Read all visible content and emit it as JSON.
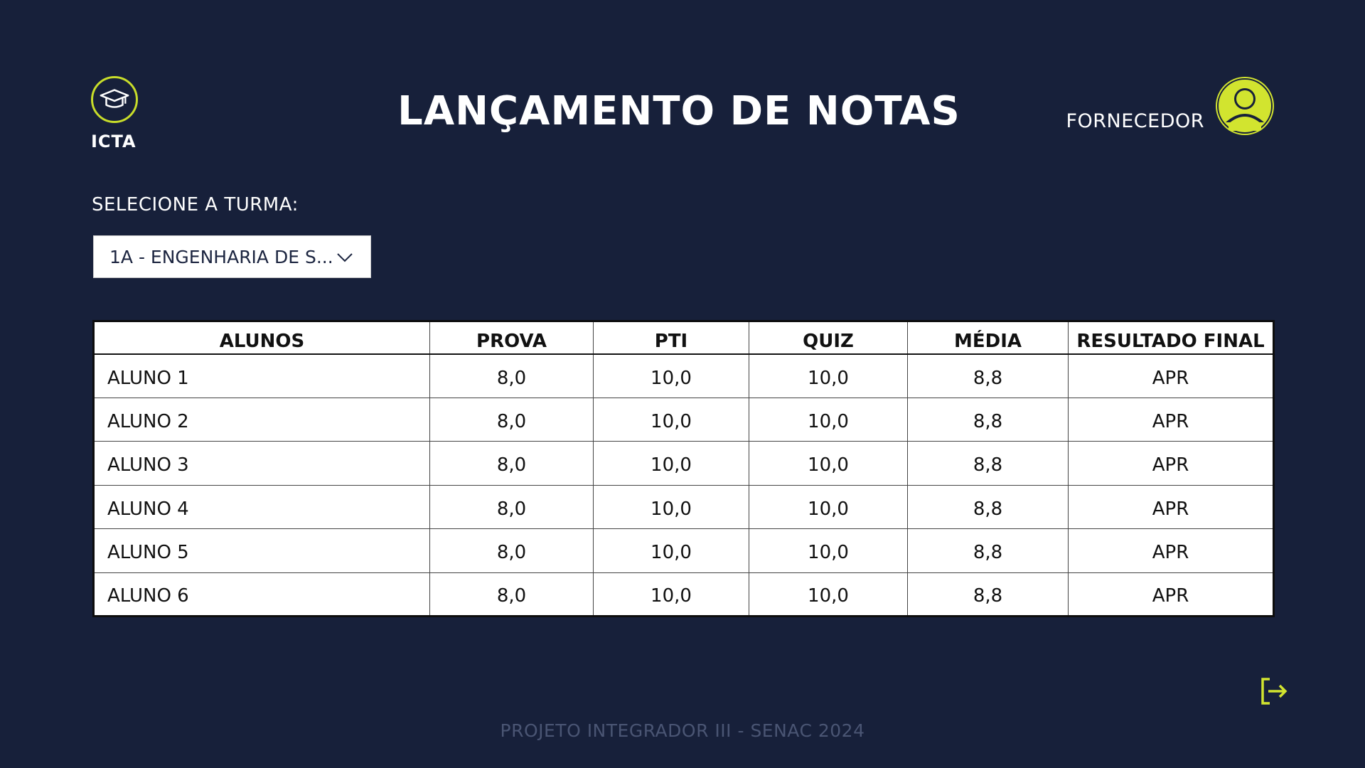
{
  "app": {
    "logo_text": "ICTA",
    "title": "LANÇAMENTO DE NOTAS"
  },
  "user": {
    "role": "FORNECEDOR"
  },
  "turma": {
    "label": "SELECIONE A TURMA:",
    "selected": "1A - ENGENHARIA DE S..."
  },
  "table": {
    "headers": [
      "ALUNOS",
      "PROVA",
      "PTI",
      "QUIZ",
      "MÉDIA",
      "RESULTADO FINAL"
    ],
    "rows": [
      [
        "ALUNO 1",
        "8,0",
        "10,0",
        "10,0",
        "8,8",
        "APR"
      ],
      [
        "ALUNO 2",
        "8,0",
        "10,0",
        "10,0",
        "8,8",
        "APR"
      ],
      [
        "ALUNO 3",
        "8,0",
        "10,0",
        "10,0",
        "8,8",
        "APR"
      ],
      [
        "ALUNO 4",
        "8,0",
        "10,0",
        "10,0",
        "8,8",
        "APR"
      ],
      [
        "ALUNO 5",
        "8,0",
        "10,0",
        "10,0",
        "8,8",
        "APR"
      ],
      [
        "ALUNO 6",
        "8,0",
        "10,0",
        "10,0",
        "8,8",
        "APR"
      ]
    ]
  },
  "footer": {
    "text": "PROJETO INTEGRADOR III - SENAC 2024"
  },
  "icons": {
    "logo": "graduation-cap-icon",
    "avatar": "user-icon",
    "dropdown": "chevron-down-icon",
    "logout": "logout-icon"
  },
  "colors": {
    "background": "#17203a",
    "accent": "#d2e42f",
    "footer_text": "#4a5573"
  }
}
